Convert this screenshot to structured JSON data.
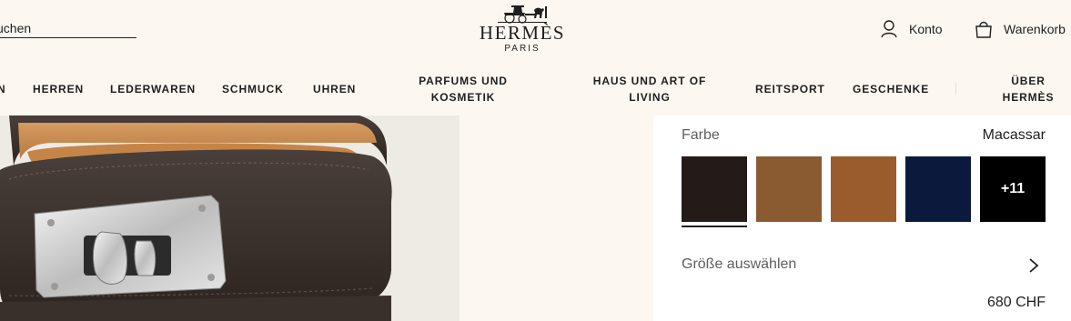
{
  "header": {
    "search_label": "uchen",
    "brand": "HERMÈS",
    "city": "PARIS",
    "account_label": "Konto",
    "cart_label": "Warenkorb"
  },
  "nav": {
    "items": [
      "N",
      "HERREN",
      "LEDERWAREN",
      "SCHMUCK",
      "UHREN",
      "PARFUMS UND\nKOSMETIK",
      "HAUS UND ART OF\nLIVING",
      "REITSPORT",
      "GESCHENKE",
      "ÜBER\nHERMÈS"
    ]
  },
  "product": {
    "color_label": "Farbe",
    "selected_color": "Macassar",
    "swatches": [
      {
        "color": "#241b19"
      },
      {
        "color": "#8a5a30"
      },
      {
        "color": "#9a5b2d"
      },
      {
        "color": "#0b1a3c"
      },
      {
        "color": "#000000",
        "label": "+11"
      }
    ],
    "size_label": "Größe auswählen",
    "price": "680 CHF"
  }
}
